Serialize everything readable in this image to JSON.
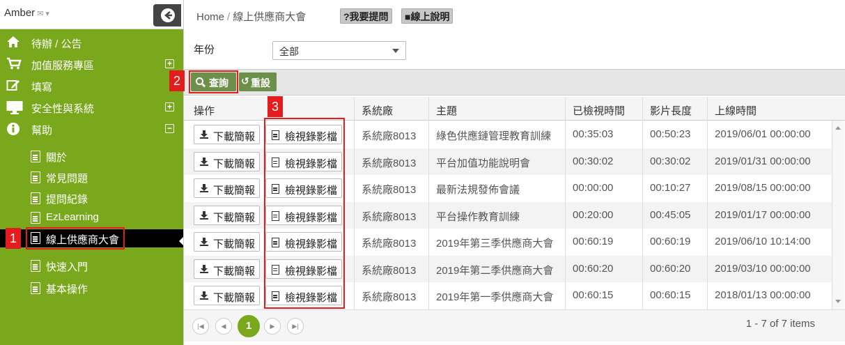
{
  "user": {
    "name": "Amber",
    "mail_icon": "✉",
    "chevron": "▾"
  },
  "sidebar": {
    "collapse_icon": "➔",
    "menu": [
      {
        "label": "待辦 / 公告",
        "icon": "home-icon",
        "toggle": ""
      },
      {
        "label": "加值服務專區",
        "icon": "cart-icon",
        "toggle": "+"
      },
      {
        "label": "填寫",
        "icon": "edit-icon",
        "toggle": ""
      },
      {
        "label": "安全性與系統",
        "icon": "monitor-icon",
        "toggle": "+"
      },
      {
        "label": "幫助",
        "icon": "info-icon",
        "toggle": "−"
      }
    ],
    "sub_items": [
      {
        "label": "關於"
      },
      {
        "label": "常見問題"
      },
      {
        "label": "提問紀錄"
      },
      {
        "label": "EzLearning"
      },
      {
        "label": "線上供應商大會",
        "active": true
      },
      {
        "label": "快速入門"
      },
      {
        "label": "基本操作"
      }
    ]
  },
  "callouts": {
    "one": "1",
    "two": "2",
    "three": "3"
  },
  "breadcrumb": {
    "home": "Home",
    "separator": "/",
    "current": "線上供應商大會"
  },
  "help": {
    "ask": "?我要提問",
    "online": "線上說明"
  },
  "filter": {
    "year_label": "年份",
    "year_value": "全部"
  },
  "toolbar": {
    "query": "查詢",
    "reset": "重設",
    "reset_icon": "↺"
  },
  "table": {
    "headers": {
      "action": "操作",
      "system": "系統廠",
      "topic": "主題",
      "watched": "已檢視時間",
      "length": "影片長度",
      "online": "上線時間"
    },
    "download_label": "下載簡報",
    "view_label": "檢視錄影檔",
    "rows": [
      {
        "system": "系統廠8013",
        "topic": "綠色供應鏈管理教育訓練",
        "watched": "00:35:03",
        "length": "00:50:23",
        "online": "2019/06/01 00:00:00"
      },
      {
        "system": "系統廠8013",
        "topic": "平台加值功能說明會",
        "watched": "00:30:02",
        "length": "00:30:02",
        "online": "2019/01/31 00:00:00"
      },
      {
        "system": "系統廠8013",
        "topic": "最新法規發佈會議",
        "watched": "00:00:00",
        "length": "00:10:27",
        "online": "2019/08/15 00:00:00"
      },
      {
        "system": "系統廠8013",
        "topic": "平台操作教育訓練",
        "watched": "00:20:00",
        "length": "00:45:05",
        "online": "2019/01/17 00:00:00"
      },
      {
        "system": "系統廠8013",
        "topic": "2019年第三季供應商大會",
        "watched": "00:60:19",
        "length": "00:60:19",
        "online": "2019/06/10 10:14:00"
      },
      {
        "system": "系統廠8013",
        "topic": "2019年第二季供應商大會",
        "watched": "00:60:20",
        "length": "00:60:20",
        "online": "2019/03/10 00:00:00"
      },
      {
        "system": "系統廠8013",
        "topic": "2019年第一季供應商大會",
        "watched": "00:60:15",
        "length": "00:60:15",
        "online": "2018/01/13 00:00:00"
      }
    ]
  },
  "pager": {
    "first": "|◀",
    "prev": "◀",
    "current": "1",
    "next": "▶",
    "last": "▶|",
    "info": "1 - 7 of 7 items"
  }
}
